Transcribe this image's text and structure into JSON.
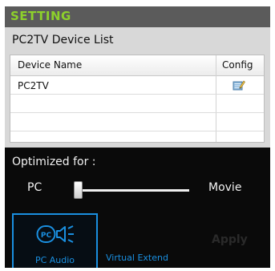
{
  "header": {
    "title": "SETTING"
  },
  "device_list": {
    "title": "PC2TV Device List",
    "columns": {
      "name": "Device Name",
      "config": "Config"
    },
    "rows": [
      {
        "name": "PC2TV"
      }
    ]
  },
  "optimize": {
    "label": "Optimized for :",
    "min_label": "PC",
    "max_label": "Movie",
    "slider_value": 0
  },
  "mode": {
    "pc_audio_label": "PC Audio",
    "pc_audio_icon_text": "PC",
    "virtual_extend_label": "Virtual Extend"
  },
  "actions": {
    "apply_label": "Apply"
  },
  "colors": {
    "accent_green": "#8dd12b",
    "accent_blue": "#1a8fe0"
  }
}
